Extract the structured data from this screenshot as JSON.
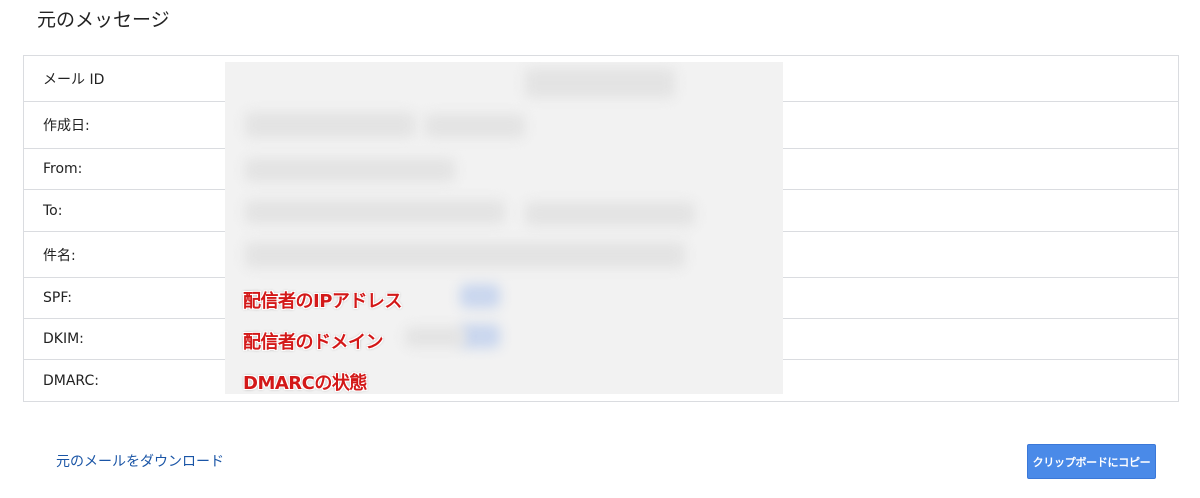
{
  "page": {
    "title": "元のメッセージ"
  },
  "details": {
    "rows": [
      {
        "label": "メール ID"
      },
      {
        "label": "作成日:"
      },
      {
        "label": "From:"
      },
      {
        "label": "To:"
      },
      {
        "label": "件名:"
      },
      {
        "label": "SPF:"
      },
      {
        "label": "DKIM:"
      },
      {
        "label": "DMARC:"
      }
    ]
  },
  "annotations": {
    "spf": "配信者のIPアドレス",
    "dkim": "配信者のドメイン",
    "dmarc": "DMARCの状態"
  },
  "actions": {
    "download_label": "元のメールをダウンロード",
    "copy_label": "クリップボードにコピー"
  },
  "colors": {
    "link": "#1a55a6",
    "button": "#4a8ae8",
    "annotation": "#d31818",
    "border": "#dadce0"
  }
}
